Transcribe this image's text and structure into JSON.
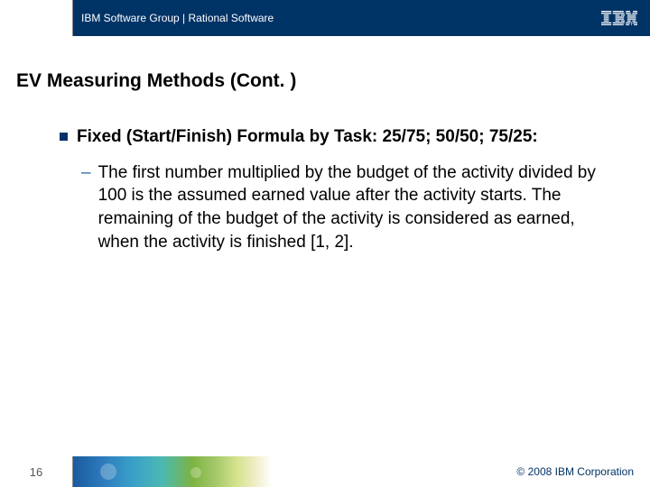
{
  "header": {
    "org_line": "IBM Software Group | Rational Software",
    "logo_label": "IBM"
  },
  "slide": {
    "title": "EV Measuring Methods (Cont. )",
    "bullets": [
      {
        "text": "Fixed (Start/Finish) Formula by Task: 25/75; 50/50; 75/25:",
        "sub": [
          "The first number multiplied by the budget of the activity divided by 100 is the assumed earned value after the activity starts. The remaining of the budget of the activity is considered as earned, when the activity is finished [1, 2]."
        ]
      }
    ]
  },
  "footer": {
    "page_number": "16",
    "copyright": "© 2008 IBM Corporation"
  }
}
